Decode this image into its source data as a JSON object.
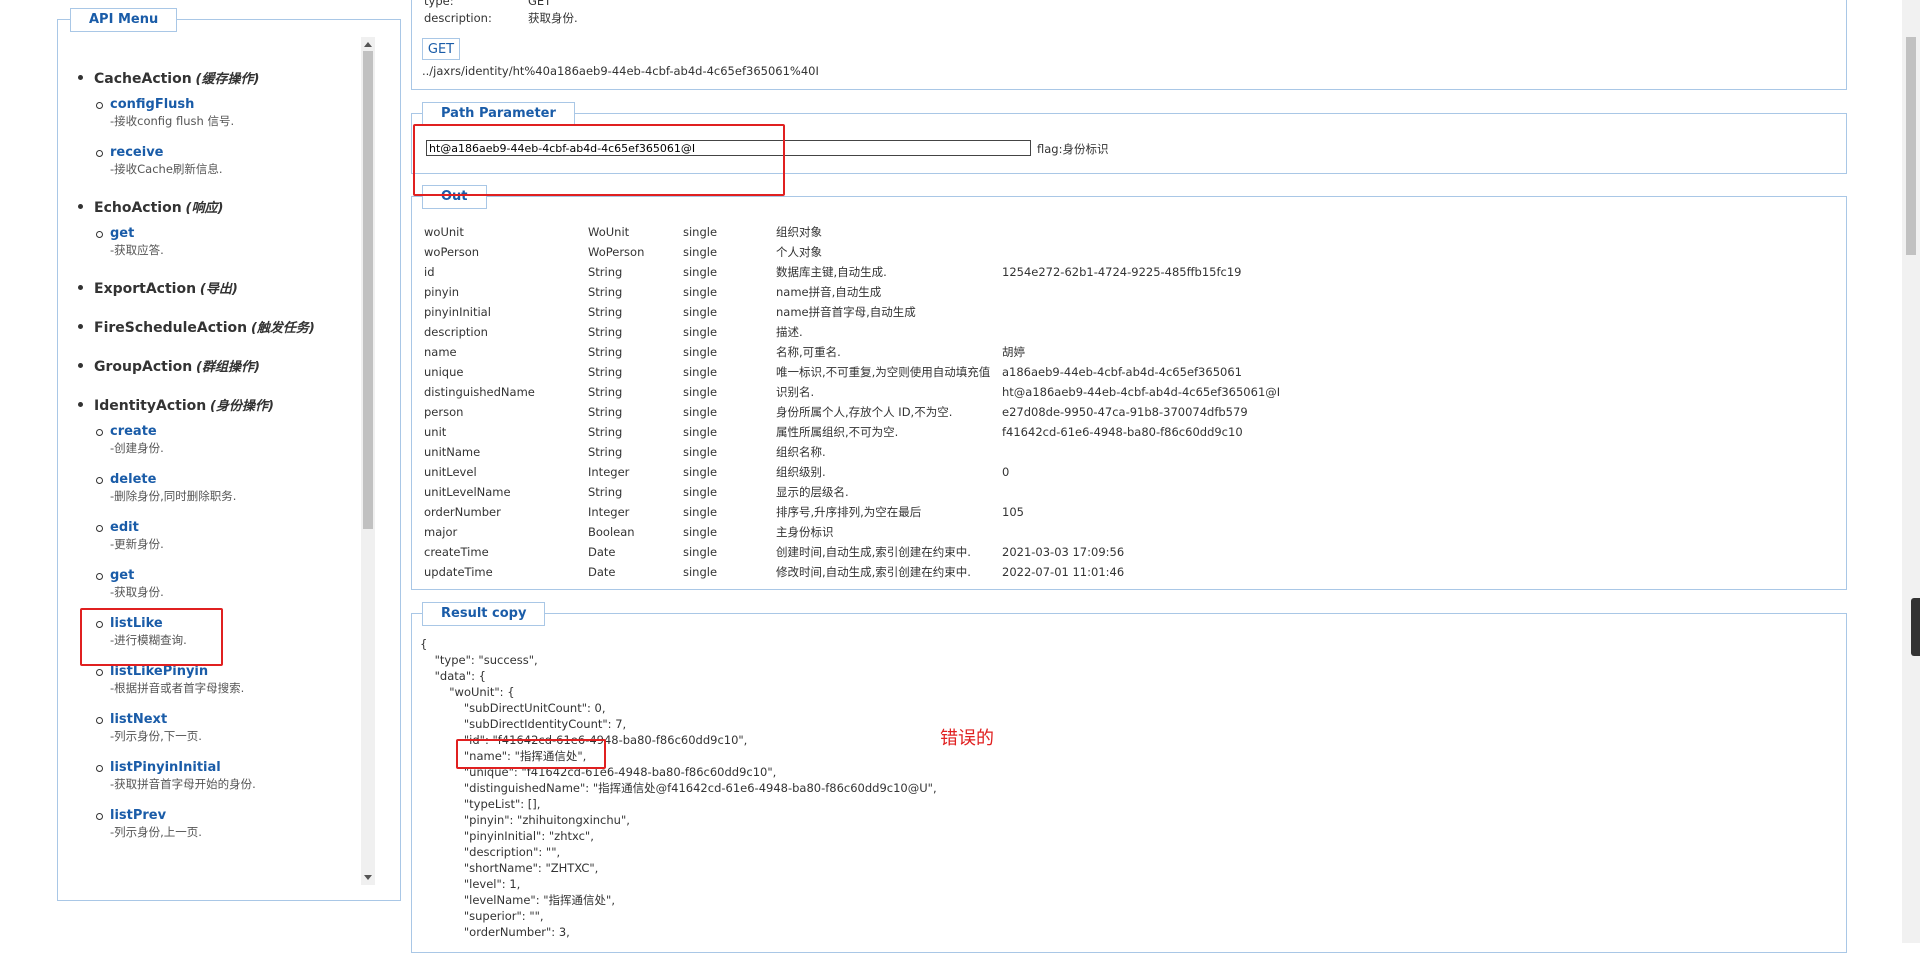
{
  "menu": {
    "title": "API Menu",
    "groups": [
      {
        "name": "CacheAction",
        "desc": "(缓存操作)",
        "items": [
          {
            "name": "configFlush",
            "desc": "-接收config flush 信号."
          },
          {
            "name": "receive",
            "desc": "-接收Cache刷新信息."
          }
        ]
      },
      {
        "name": "EchoAction",
        "desc": "(响应)",
        "items": [
          {
            "name": "get",
            "desc": "-获取应答."
          }
        ]
      },
      {
        "name": "ExportAction",
        "desc": "(导出)",
        "items": []
      },
      {
        "name": "FireScheduleAction",
        "desc": "(触发任务)",
        "items": []
      },
      {
        "name": "GroupAction",
        "desc": "(群组操作)",
        "items": []
      },
      {
        "name": "IdentityAction",
        "desc": "(身份操作)",
        "items": [
          {
            "name": "create",
            "desc": "-创建身份."
          },
          {
            "name": "delete",
            "desc": "-删除身份,同时删除职务."
          },
          {
            "name": "edit",
            "desc": "-更新身份."
          },
          {
            "name": "get",
            "desc": "-获取身份."
          },
          {
            "name": "listLike",
            "desc": "-进行模糊查询."
          },
          {
            "name": "listLikePinyin",
            "desc": "-根据拼音或者首字母搜索."
          },
          {
            "name": "listNext",
            "desc": "-列示身份,下一页."
          },
          {
            "name": "listPinyinInitial",
            "desc": "-获取拼音首字母开始的身份."
          },
          {
            "name": "listPrev",
            "desc": "-列示身份,上一页."
          }
        ]
      }
    ]
  },
  "top": {
    "type_key": "type:",
    "type_val": "GET",
    "desc_key": "description:",
    "desc_val": "获取身份.",
    "method_button": "GET",
    "url": "../jaxrs/identity/ht%40a186aeb9-44eb-4cbf-ab4d-4c65ef365061%40I"
  },
  "path": {
    "title": "Path Parameter",
    "value": "ht@a186aeb9-44eb-4cbf-ab4d-4c65ef365061@I",
    "note": "flag:身份标识"
  },
  "out": {
    "title": "Out",
    "rows": [
      [
        "woUnit",
        "WoUnit",
        "single",
        "组织对象",
        ""
      ],
      [
        "woPerson",
        "WoPerson",
        "single",
        "个人对象",
        ""
      ],
      [
        "id",
        "String",
        "single",
        "数据库主键,自动生成.",
        "1254e272-62b1-4724-9225-485ffb15fc19"
      ],
      [
        "pinyin",
        "String",
        "single",
        "name拼音,自动生成",
        ""
      ],
      [
        "pinyinInitial",
        "String",
        "single",
        "name拼音首字母,自动生成",
        ""
      ],
      [
        "description",
        "String",
        "single",
        "描述.",
        ""
      ],
      [
        "name",
        "String",
        "single",
        "名称,可重名.",
        "胡婷"
      ],
      [
        "unique",
        "String",
        "single",
        "唯一标识,不可重复,为空则使用自动填充值",
        "a186aeb9-44eb-4cbf-ab4d-4c65ef365061"
      ],
      [
        "distinguishedName",
        "String",
        "single",
        "识别名.",
        "ht@a186aeb9-44eb-4cbf-ab4d-4c65ef365061@I"
      ],
      [
        "person",
        "String",
        "single",
        "身份所属个人,存放个人 ID,不为空.",
        "e27d08de-9950-47ca-91b8-370074dfb579"
      ],
      [
        "unit",
        "String",
        "single",
        "属性所属组织,不可为空.",
        "f41642cd-61e6-4948-ba80-f86c60dd9c10"
      ],
      [
        "unitName",
        "String",
        "single",
        "组织名称.",
        ""
      ],
      [
        "unitLevel",
        "Integer",
        "single",
        "组织级别.",
        "0"
      ],
      [
        "unitLevelName",
        "String",
        "single",
        "显示的层级名.",
        ""
      ],
      [
        "orderNumber",
        "Integer",
        "single",
        "排序号,升序排列,为空在最后",
        "105"
      ],
      [
        "major",
        "Boolean",
        "single",
        "主身份标识",
        ""
      ],
      [
        "createTime",
        "Date",
        "single",
        "创建时间,自动生成,索引创建在约束中.",
        "2021-03-03 17:09:56"
      ],
      [
        "updateTime",
        "Date",
        "single",
        "修改时间,自动生成,索引创建在约束中.",
        "2022-07-01 11:01:46"
      ]
    ]
  },
  "result": {
    "title": "Result copy",
    "json_text": "{\n    \"type\": \"success\",\n    \"data\": {\n        \"woUnit\": {\n            \"subDirectUnitCount\": 0,\n            \"subDirectIdentityCount\": 7,\n            \"id\": \"f41642cd-61e6-4948-ba80-f86c60dd9c10\",\n            \"name\": \"指挥通信处\",\n            \"unique\": \"f41642cd-61e6-4948-ba80-f86c60dd9c10\",\n            \"distinguishedName\": \"指挥通信处@f41642cd-61e6-4948-ba80-f86c60dd9c10@U\",\n            \"typeList\": [],\n            \"pinyin\": \"zhihuitongxinchu\",\n            \"pinyinInitial\": \"zhtxc\",\n            \"description\": \"\",\n            \"shortName\": \"ZHTXC\",\n            \"level\": 1,\n            \"levelName\": \"指挥通信处\",\n            \"superior\": \"\",\n            \"orderNumber\": 3,"
  },
  "annotation": {
    "note": "错误的",
    "color": "#e02020"
  },
  "colors": {
    "accent": "#1a5ca8",
    "border": "#a9c7e6"
  }
}
